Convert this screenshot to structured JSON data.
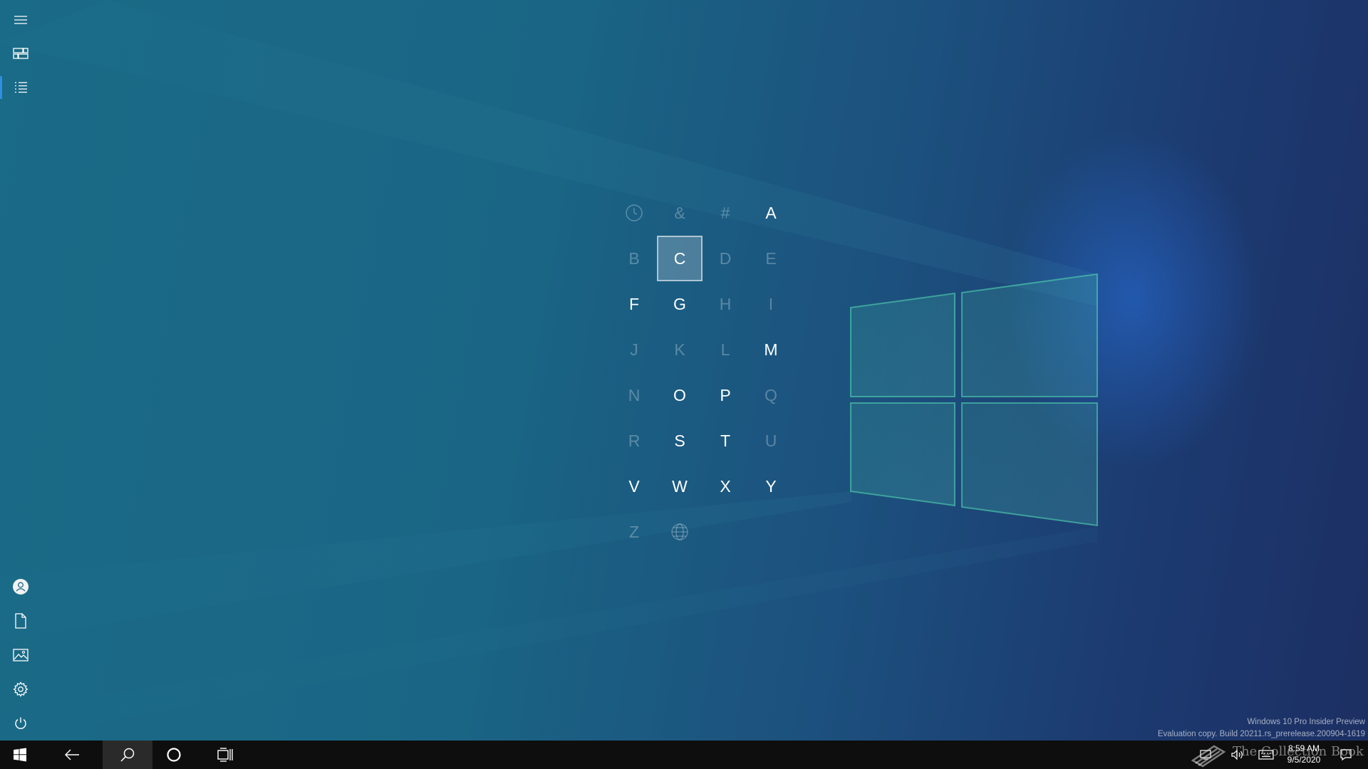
{
  "rail": {
    "top_items": [
      {
        "name": "hamburger-menu-icon"
      },
      {
        "name": "tiles-view-icon"
      },
      {
        "name": "all-apps-list-icon",
        "active": true
      }
    ],
    "bottom_items": [
      {
        "name": "user-account-icon"
      },
      {
        "name": "documents-icon"
      },
      {
        "name": "pictures-icon"
      },
      {
        "name": "settings-gear-icon"
      },
      {
        "name": "power-icon"
      }
    ],
    "accent_color": "#2f8fe0"
  },
  "jump_list": {
    "selected": "C",
    "cells": [
      {
        "label": "",
        "icon": "clock-icon",
        "enabled": false
      },
      {
        "label": "&",
        "enabled": false
      },
      {
        "label": "#",
        "enabled": false
      },
      {
        "label": "A",
        "enabled": true
      },
      {
        "label": "B",
        "enabled": false
      },
      {
        "label": "C",
        "enabled": true
      },
      {
        "label": "D",
        "enabled": false
      },
      {
        "label": "E",
        "enabled": false
      },
      {
        "label": "F",
        "enabled": true
      },
      {
        "label": "G",
        "enabled": true
      },
      {
        "label": "H",
        "enabled": false
      },
      {
        "label": "I",
        "enabled": false
      },
      {
        "label": "J",
        "enabled": false
      },
      {
        "label": "K",
        "enabled": false
      },
      {
        "label": "L",
        "enabled": false
      },
      {
        "label": "M",
        "enabled": true
      },
      {
        "label": "N",
        "enabled": false
      },
      {
        "label": "O",
        "enabled": true
      },
      {
        "label": "P",
        "enabled": true
      },
      {
        "label": "Q",
        "enabled": false
      },
      {
        "label": "R",
        "enabled": false
      },
      {
        "label": "S",
        "enabled": true
      },
      {
        "label": "T",
        "enabled": true
      },
      {
        "label": "U",
        "enabled": false
      },
      {
        "label": "V",
        "enabled": true
      },
      {
        "label": "W",
        "enabled": true
      },
      {
        "label": "X",
        "enabled": true
      },
      {
        "label": "Y",
        "enabled": true
      },
      {
        "label": "Z",
        "enabled": false
      },
      {
        "label": "",
        "icon": "globe-icon",
        "enabled": false
      }
    ]
  },
  "watermark": {
    "line1": "Windows 10 Pro Insider Preview",
    "line2": "Evaluation copy. Build 20211.rs_prerelease.200904-1619"
  },
  "taskbar": {
    "buttons": [
      {
        "name": "start-button",
        "icon": "windows-logo-icon"
      },
      {
        "name": "back-button",
        "icon": "back-arrow-icon"
      },
      {
        "name": "search-button",
        "icon": "search-icon",
        "active": true
      },
      {
        "name": "cortana-button",
        "icon": "cortana-circle-icon"
      },
      {
        "name": "task-view-button",
        "icon": "task-view-icon"
      }
    ],
    "tray": {
      "icons": [
        "network-icon",
        "volume-icon",
        "keyboard-icon",
        "action-center-icon"
      ],
      "time": "8:59 AM",
      "date": "9/5/2020"
    }
  },
  "overlay_brand": "The Collection Book"
}
